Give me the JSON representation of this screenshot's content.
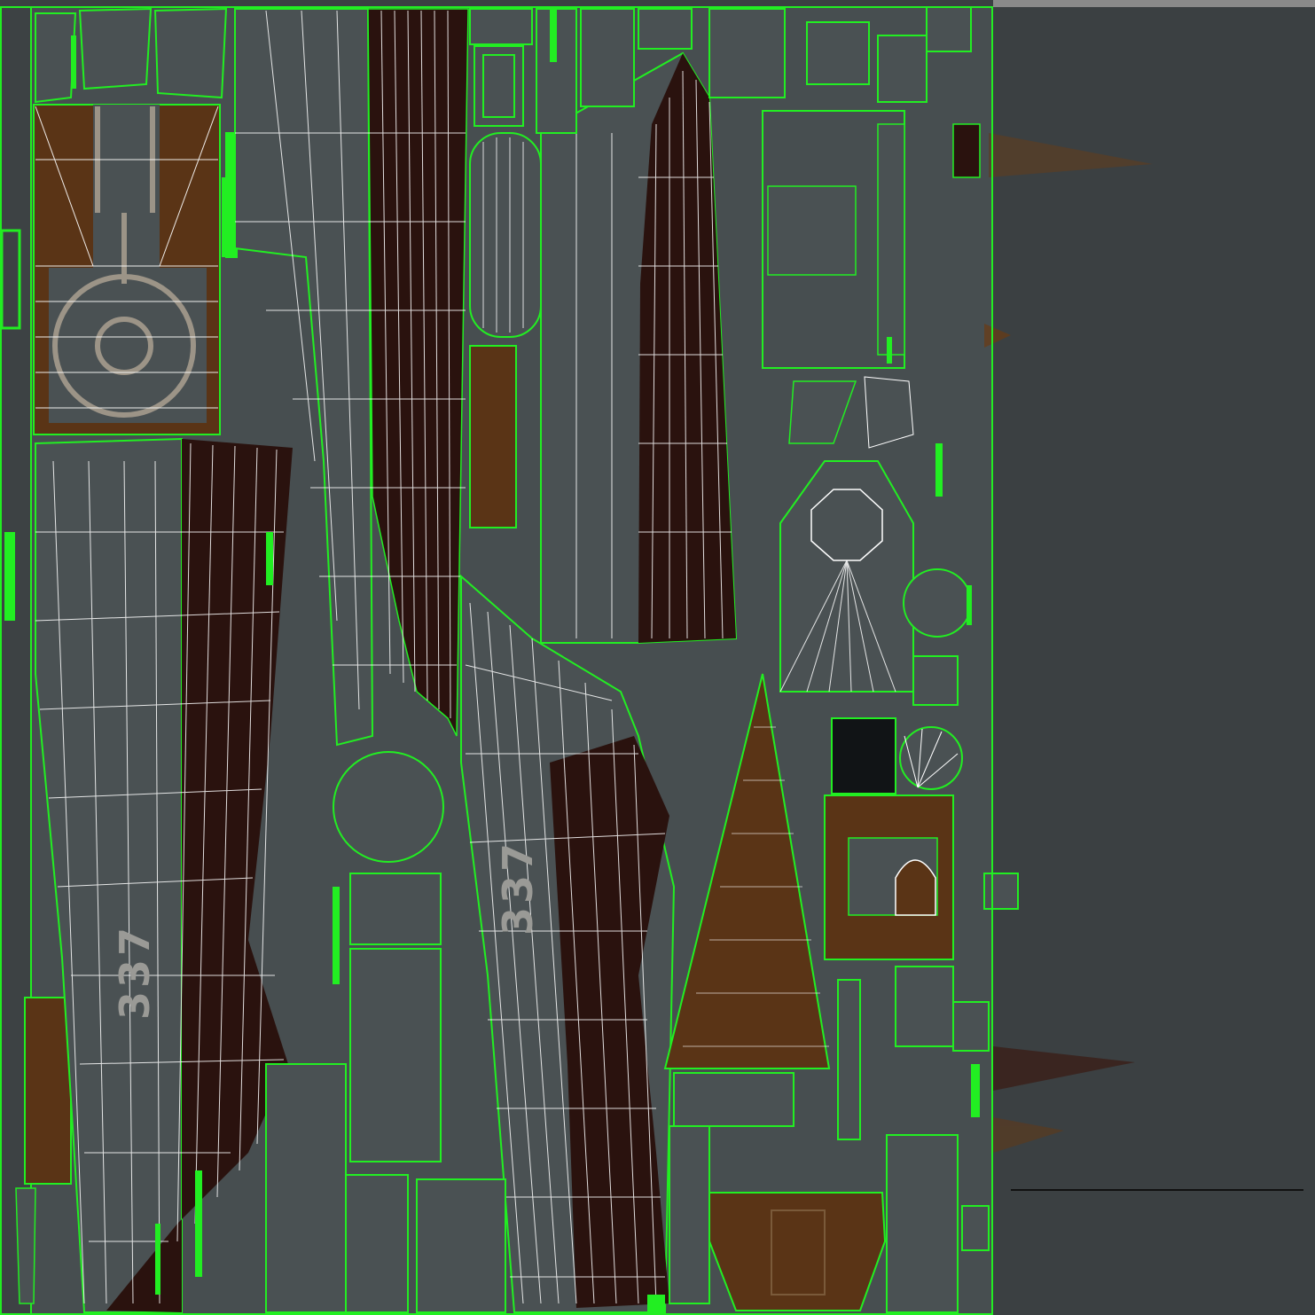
{
  "texture": {
    "hull_numbers": [
      "337",
      "337"
    ],
    "pad_number": "337"
  },
  "colors": {
    "background": "#3b4042",
    "panel_gray": "#4a5153",
    "deck_brown": "#2a120e",
    "rust_brown": "#5a3416",
    "uv_edge_green": "#22ee22",
    "uv_wire_white": "#ffffff",
    "marking_tan": "#9c9487"
  }
}
